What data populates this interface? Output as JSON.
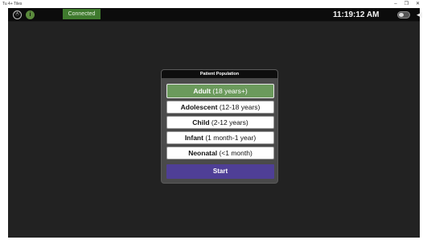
{
  "window": {
    "title": "Tu 4+ Tiles",
    "minimize": "–",
    "maximize": "❐",
    "close": "✕"
  },
  "header": {
    "logo_glyph": "Ⓐ",
    "info_glyph": "i",
    "status": "Connected",
    "status_color": "#3f7a2e",
    "time": "11:19:12 AM",
    "speaker_glyph": "◀"
  },
  "dialog": {
    "title": "Patient Population",
    "options": [
      {
        "name": "Adult",
        "range": "(18 years+)",
        "selected": true
      },
      {
        "name": "Adolescent",
        "range": "(12-18 years)",
        "selected": false
      },
      {
        "name": "Child",
        "range": "(2-12 years)",
        "selected": false
      },
      {
        "name": "Infant",
        "range": "(1 month-1 year)",
        "selected": false
      },
      {
        "name": "Neonatal",
        "range": "(<1 month)",
        "selected": false
      }
    ],
    "start_label": "Start",
    "selected_color": "#6b9a5c",
    "start_color": "#4f3f96"
  }
}
